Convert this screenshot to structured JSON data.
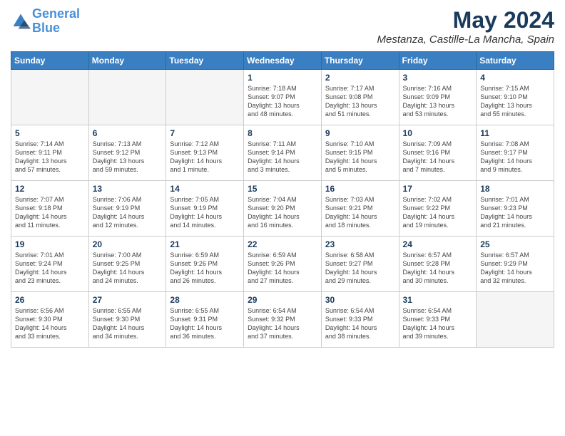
{
  "header": {
    "logo_line1": "General",
    "logo_line2": "Blue",
    "month_year": "May 2024",
    "location": "Mestanza, Castille-La Mancha, Spain"
  },
  "days_of_week": [
    "Sunday",
    "Monday",
    "Tuesday",
    "Wednesday",
    "Thursday",
    "Friday",
    "Saturday"
  ],
  "weeks": [
    [
      {
        "day": "",
        "info": ""
      },
      {
        "day": "",
        "info": ""
      },
      {
        "day": "",
        "info": ""
      },
      {
        "day": "1",
        "info": "Sunrise: 7:18 AM\nSunset: 9:07 PM\nDaylight: 13 hours\nand 48 minutes."
      },
      {
        "day": "2",
        "info": "Sunrise: 7:17 AM\nSunset: 9:08 PM\nDaylight: 13 hours\nand 51 minutes."
      },
      {
        "day": "3",
        "info": "Sunrise: 7:16 AM\nSunset: 9:09 PM\nDaylight: 13 hours\nand 53 minutes."
      },
      {
        "day": "4",
        "info": "Sunrise: 7:15 AM\nSunset: 9:10 PM\nDaylight: 13 hours\nand 55 minutes."
      }
    ],
    [
      {
        "day": "5",
        "info": "Sunrise: 7:14 AM\nSunset: 9:11 PM\nDaylight: 13 hours\nand 57 minutes."
      },
      {
        "day": "6",
        "info": "Sunrise: 7:13 AM\nSunset: 9:12 PM\nDaylight: 13 hours\nand 59 minutes."
      },
      {
        "day": "7",
        "info": "Sunrise: 7:12 AM\nSunset: 9:13 PM\nDaylight: 14 hours\nand 1 minute."
      },
      {
        "day": "8",
        "info": "Sunrise: 7:11 AM\nSunset: 9:14 PM\nDaylight: 14 hours\nand 3 minutes."
      },
      {
        "day": "9",
        "info": "Sunrise: 7:10 AM\nSunset: 9:15 PM\nDaylight: 14 hours\nand 5 minutes."
      },
      {
        "day": "10",
        "info": "Sunrise: 7:09 AM\nSunset: 9:16 PM\nDaylight: 14 hours\nand 7 minutes."
      },
      {
        "day": "11",
        "info": "Sunrise: 7:08 AM\nSunset: 9:17 PM\nDaylight: 14 hours\nand 9 minutes."
      }
    ],
    [
      {
        "day": "12",
        "info": "Sunrise: 7:07 AM\nSunset: 9:18 PM\nDaylight: 14 hours\nand 11 minutes."
      },
      {
        "day": "13",
        "info": "Sunrise: 7:06 AM\nSunset: 9:19 PM\nDaylight: 14 hours\nand 12 minutes."
      },
      {
        "day": "14",
        "info": "Sunrise: 7:05 AM\nSunset: 9:19 PM\nDaylight: 14 hours\nand 14 minutes."
      },
      {
        "day": "15",
        "info": "Sunrise: 7:04 AM\nSunset: 9:20 PM\nDaylight: 14 hours\nand 16 minutes."
      },
      {
        "day": "16",
        "info": "Sunrise: 7:03 AM\nSunset: 9:21 PM\nDaylight: 14 hours\nand 18 minutes."
      },
      {
        "day": "17",
        "info": "Sunrise: 7:02 AM\nSunset: 9:22 PM\nDaylight: 14 hours\nand 19 minutes."
      },
      {
        "day": "18",
        "info": "Sunrise: 7:01 AM\nSunset: 9:23 PM\nDaylight: 14 hours\nand 21 minutes."
      }
    ],
    [
      {
        "day": "19",
        "info": "Sunrise: 7:01 AM\nSunset: 9:24 PM\nDaylight: 14 hours\nand 23 minutes."
      },
      {
        "day": "20",
        "info": "Sunrise: 7:00 AM\nSunset: 9:25 PM\nDaylight: 14 hours\nand 24 minutes."
      },
      {
        "day": "21",
        "info": "Sunrise: 6:59 AM\nSunset: 9:26 PM\nDaylight: 14 hours\nand 26 minutes."
      },
      {
        "day": "22",
        "info": "Sunrise: 6:59 AM\nSunset: 9:26 PM\nDaylight: 14 hours\nand 27 minutes."
      },
      {
        "day": "23",
        "info": "Sunrise: 6:58 AM\nSunset: 9:27 PM\nDaylight: 14 hours\nand 29 minutes."
      },
      {
        "day": "24",
        "info": "Sunrise: 6:57 AM\nSunset: 9:28 PM\nDaylight: 14 hours\nand 30 minutes."
      },
      {
        "day": "25",
        "info": "Sunrise: 6:57 AM\nSunset: 9:29 PM\nDaylight: 14 hours\nand 32 minutes."
      }
    ],
    [
      {
        "day": "26",
        "info": "Sunrise: 6:56 AM\nSunset: 9:30 PM\nDaylight: 14 hours\nand 33 minutes."
      },
      {
        "day": "27",
        "info": "Sunrise: 6:55 AM\nSunset: 9:30 PM\nDaylight: 14 hours\nand 34 minutes."
      },
      {
        "day": "28",
        "info": "Sunrise: 6:55 AM\nSunset: 9:31 PM\nDaylight: 14 hours\nand 36 minutes."
      },
      {
        "day": "29",
        "info": "Sunrise: 6:54 AM\nSunset: 9:32 PM\nDaylight: 14 hours\nand 37 minutes."
      },
      {
        "day": "30",
        "info": "Sunrise: 6:54 AM\nSunset: 9:33 PM\nDaylight: 14 hours\nand 38 minutes."
      },
      {
        "day": "31",
        "info": "Sunrise: 6:54 AM\nSunset: 9:33 PM\nDaylight: 14 hours\nand 39 minutes."
      },
      {
        "day": "",
        "info": ""
      }
    ]
  ]
}
